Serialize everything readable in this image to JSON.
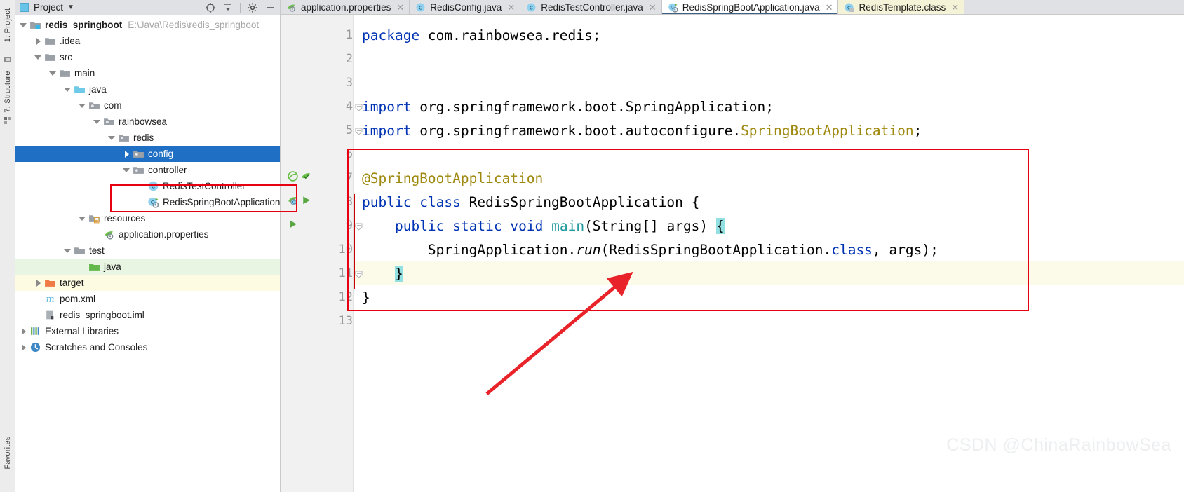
{
  "window": {
    "ide": "IntelliJ IDEA",
    "watermark": "CSDN @ChinaRainbowSea"
  },
  "tool_strip": {
    "project_tab": "1: Project",
    "structure_tab": "7: Structure",
    "favorites_tab": "Favorites"
  },
  "project_panel": {
    "title": "Project",
    "dropdown_caret": "▼",
    "header_icons": [
      "locate-icon",
      "collapse-all-icon",
      "settings-gear-icon",
      "hide-icon"
    ],
    "tree": [
      {
        "label": "redis_springboot",
        "path": "E:\\Java\\Redis\\redis_springboot",
        "indent": 0,
        "arrow": "open",
        "icon": "module-folder-icon",
        "bold": true,
        "state": "normal"
      },
      {
        "label": ".idea",
        "path": "",
        "indent": 1,
        "arrow": "closed",
        "icon": "folder-icon",
        "bold": false,
        "state": "normal"
      },
      {
        "label": "src",
        "path": "",
        "indent": 1,
        "arrow": "open",
        "icon": "folder-icon",
        "bold": false,
        "state": "normal"
      },
      {
        "label": "main",
        "path": "",
        "indent": 2,
        "arrow": "open",
        "icon": "folder-icon",
        "bold": false,
        "state": "normal"
      },
      {
        "label": "java",
        "path": "",
        "indent": 3,
        "arrow": "open",
        "icon": "source-root-folder-icon",
        "bold": false,
        "state": "normal"
      },
      {
        "label": "com",
        "path": "",
        "indent": 4,
        "arrow": "open",
        "icon": "package-icon",
        "bold": false,
        "state": "normal"
      },
      {
        "label": "rainbowsea",
        "path": "",
        "indent": 5,
        "arrow": "open",
        "icon": "package-icon",
        "bold": false,
        "state": "normal"
      },
      {
        "label": "redis",
        "path": "",
        "indent": 6,
        "arrow": "open",
        "icon": "package-icon",
        "bold": false,
        "state": "normal"
      },
      {
        "label": "config",
        "path": "",
        "indent": 7,
        "arrow": "closed",
        "icon": "package-icon",
        "bold": false,
        "state": "selected"
      },
      {
        "label": "controller",
        "path": "",
        "indent": 7,
        "arrow": "open",
        "icon": "package-icon",
        "bold": false,
        "state": "normal"
      },
      {
        "label": "RedisTestController",
        "path": "",
        "indent": 8,
        "arrow": "none",
        "icon": "java-class-icon",
        "bold": false,
        "state": "normal"
      },
      {
        "label": "RedisSpringBootApplication",
        "path": "",
        "indent": 8,
        "arrow": "none",
        "icon": "spring-boot-class-icon",
        "bold": false,
        "state": "highlighted"
      },
      {
        "label": "resources",
        "path": "",
        "indent": 4,
        "arrow": "open",
        "icon": "resources-folder-icon",
        "bold": false,
        "state": "normal"
      },
      {
        "label": "application.properties",
        "path": "",
        "indent": 5,
        "arrow": "none",
        "icon": "spring-properties-icon",
        "bold": false,
        "state": "normal"
      },
      {
        "label": "test",
        "path": "",
        "indent": 3,
        "arrow": "open",
        "icon": "folder-icon",
        "bold": false,
        "state": "normal"
      },
      {
        "label": "java",
        "path": "",
        "indent": 4,
        "arrow": "none",
        "icon": "test-source-folder-icon",
        "bold": false,
        "state": "green-row"
      },
      {
        "label": "target",
        "path": "",
        "indent": 1,
        "arrow": "closed",
        "icon": "excluded-folder-icon",
        "bold": false,
        "state": "yellow-row"
      },
      {
        "label": "pom.xml",
        "path": "",
        "indent": 1,
        "arrow": "none",
        "icon": "maven-xml-icon",
        "bold": false,
        "state": "normal"
      },
      {
        "label": "redis_springboot.iml",
        "path": "",
        "indent": 1,
        "arrow": "none",
        "icon": "iml-file-icon",
        "bold": false,
        "state": "normal"
      },
      {
        "label": "External Libraries",
        "path": "",
        "indent": 0,
        "arrow": "closed",
        "icon": "libraries-icon",
        "bold": false,
        "state": "normal"
      },
      {
        "label": "Scratches and Consoles",
        "path": "",
        "indent": 0,
        "arrow": "closed",
        "icon": "scratches-icon",
        "bold": false,
        "state": "normal"
      }
    ]
  },
  "editor": {
    "tabs": [
      {
        "label": "application.properties",
        "icon": "spring-properties-icon",
        "active": false,
        "style": "normal",
        "close": "✕"
      },
      {
        "label": "RedisConfig.java",
        "icon": "java-class-icon",
        "active": false,
        "style": "normal",
        "close": "✕"
      },
      {
        "label": "RedisTestController.java",
        "icon": "java-class-icon",
        "active": false,
        "style": "normal",
        "close": "✕"
      },
      {
        "label": "RedisSpringBootApplication.java",
        "icon": "spring-boot-class-icon",
        "active": true,
        "style": "normal",
        "close": "✕"
      },
      {
        "label": "RedisTemplate.class",
        "icon": "java-class-file-icon",
        "active": false,
        "style": "classfile",
        "close": "✕"
      }
    ],
    "line_numbers": [
      "1",
      "2",
      "3",
      "4",
      "5",
      "6",
      "7",
      "8",
      "9",
      "10",
      "11",
      "12",
      "13"
    ],
    "current_line": 11,
    "gutter_icons": {
      "line7": [
        "spring-bean-candidate-icon",
        "spring-config-check-icon"
      ],
      "line8": [
        "spring-boot-app-icon",
        "run-arrow-icon"
      ],
      "line9": [
        "run-arrow-icon"
      ]
    },
    "code_lines": [
      {
        "n": 1,
        "tokens": [
          {
            "t": "package",
            "c": "k"
          },
          {
            "t": " com.rainbowsea.redis;",
            "c": ""
          }
        ]
      },
      {
        "n": 2,
        "tokens": []
      },
      {
        "n": 3,
        "tokens": []
      },
      {
        "n": 4,
        "tokens": [
          {
            "t": "import",
            "c": "k"
          },
          {
            "t": " org.springframework.boot.SpringApplication;",
            "c": ""
          }
        ]
      },
      {
        "n": 5,
        "tokens": [
          {
            "t": "import",
            "c": "k"
          },
          {
            "t": " org.springframework.boot.autoconfigure.",
            "c": ""
          },
          {
            "t": "SpringBootApplication",
            "c": "ann"
          },
          {
            "t": ";",
            "c": ""
          }
        ]
      },
      {
        "n": 6,
        "tokens": []
      },
      {
        "n": 7,
        "tokens": [
          {
            "t": "@SpringBootApplication",
            "c": "ann"
          }
        ]
      },
      {
        "n": 8,
        "tokens": [
          {
            "t": "public",
            "c": "k"
          },
          {
            "t": " ",
            "c": ""
          },
          {
            "t": "class",
            "c": "k"
          },
          {
            "t": " RedisSpringBootApplication {",
            "c": ""
          }
        ]
      },
      {
        "n": 9,
        "tokens": [
          {
            "t": "    ",
            "c": ""
          },
          {
            "t": "public",
            "c": "k"
          },
          {
            "t": " ",
            "c": ""
          },
          {
            "t": "static",
            "c": "k"
          },
          {
            "t": " ",
            "c": ""
          },
          {
            "t": "void",
            "c": "k"
          },
          {
            "t": " ",
            "c": ""
          },
          {
            "t": "main",
            "c": "type"
          },
          {
            "t": "(String[] args) ",
            "c": ""
          },
          {
            "t": "{",
            "c": "brace-hl"
          }
        ]
      },
      {
        "n": 10,
        "tokens": [
          {
            "t": "        SpringApplication.",
            "c": ""
          },
          {
            "t": "run",
            "c": "mi"
          },
          {
            "t": "(RedisSpringBootApplication.",
            "c": ""
          },
          {
            "t": "class",
            "c": "k"
          },
          {
            "t": ", args);",
            "c": ""
          }
        ]
      },
      {
        "n": 11,
        "tokens": [
          {
            "t": "    ",
            "c": ""
          },
          {
            "t": "}",
            "c": "brace-hl"
          }
        ]
      },
      {
        "n": 12,
        "tokens": [
          {
            "t": "}",
            "c": ""
          }
        ]
      },
      {
        "n": 13,
        "tokens": []
      }
    ]
  },
  "annotations": {
    "red_box_tree": {
      "label": "highlight-around-RedisSpringBootApplication-node"
    },
    "red_box_code": {
      "label": "highlight-around-class-body"
    },
    "arrow": {
      "label": "red-arrow-pointing-to-code-block",
      "color": "#e8232a"
    }
  },
  "colors": {
    "selection_blue": "#1f6fc4",
    "annotation_red": "#e60012",
    "keyword_blue": "#0033b3",
    "annotation_gold": "#9e880d",
    "brace_highlight": "#93e0e3",
    "current_line": "#fcfae8"
  }
}
